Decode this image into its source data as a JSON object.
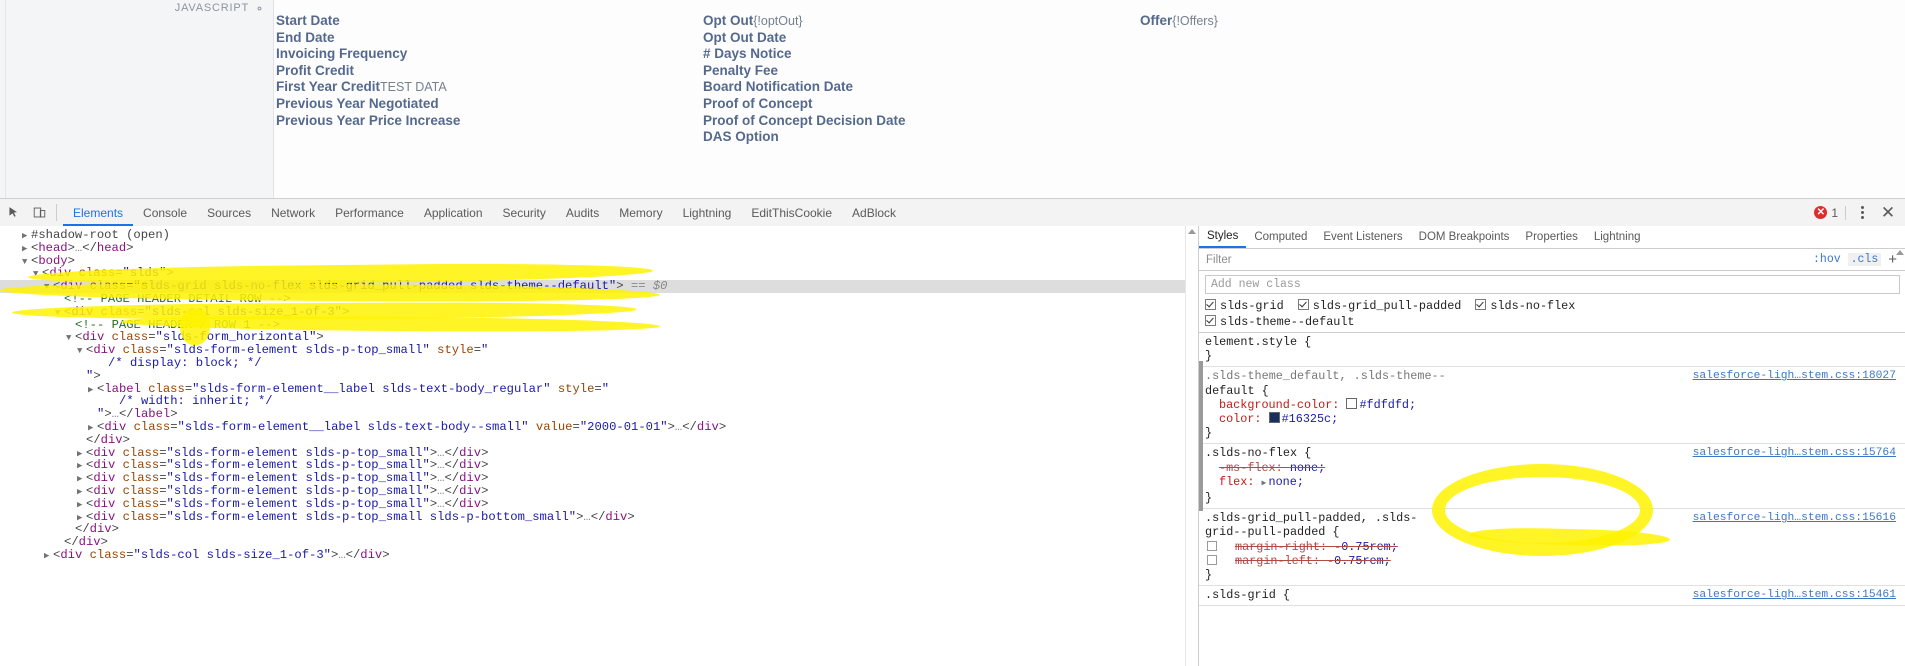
{
  "page": {
    "javascript_badge": "JAVASCRIPT",
    "gear_icon": "gear-icon",
    "columns": [
      {
        "name": "column-1",
        "fields": [
          {
            "label": "Start Date",
            "value": ""
          },
          {
            "label": "End Date",
            "value": ""
          },
          {
            "label": "Invoicing Frequency",
            "value": ""
          },
          {
            "label": "Profit Credit",
            "value": ""
          },
          {
            "label": "First Year Credit",
            "value": "TEST DATA"
          },
          {
            "label": "Previous Year Negotiated",
            "value": ""
          },
          {
            "label": "Previous Year Price Increase",
            "value": ""
          }
        ]
      },
      {
        "name": "column-2",
        "fields": [
          {
            "label": "Opt Out",
            "value": "{!optOut}"
          },
          {
            "label": "Opt Out Date",
            "value": ""
          },
          {
            "label": "# Days Notice",
            "value": ""
          },
          {
            "label": "Penalty Fee",
            "value": ""
          },
          {
            "label": "Board Notification Date",
            "value": ""
          },
          {
            "label": "Proof of Concept",
            "value": ""
          },
          {
            "label": "Proof of Concept Decision Date",
            "value": ""
          },
          {
            "label": "DAS Option",
            "value": ""
          }
        ]
      },
      {
        "name": "column-3",
        "fields": [
          {
            "label": "Offer",
            "value": "{!Offers}"
          }
        ]
      }
    ]
  },
  "devtools": {
    "tabs": [
      {
        "label": "Elements",
        "active": true
      },
      {
        "label": "Console",
        "active": false
      },
      {
        "label": "Sources",
        "active": false
      },
      {
        "label": "Network",
        "active": false
      },
      {
        "label": "Performance",
        "active": false
      },
      {
        "label": "Application",
        "active": false
      },
      {
        "label": "Security",
        "active": false
      },
      {
        "label": "Audits",
        "active": false
      },
      {
        "label": "Memory",
        "active": false
      },
      {
        "label": "Lightning",
        "active": false
      },
      {
        "label": "EditThisCookie",
        "active": false
      },
      {
        "label": "AdBlock",
        "active": false
      }
    ],
    "inspect_icon": "cursor-inspect-icon",
    "device_icon": "device-toolbar-icon",
    "error_count": "1",
    "error_icon": "error-circle-icon",
    "menu_icon": "kebab-menu-icon",
    "close_icon": "close-icon",
    "dom": {
      "lines": [
        {
          "indent": 2,
          "tri": "closed",
          "html": "<span class=\"shadow\">#shadow-root (open)</span>"
        },
        {
          "indent": 2,
          "tri": "closed",
          "html": "<span class=\"pun\">&lt;</span><span class=\"tg\">head</span><span class=\"pun\">&gt;</span><span class=\"ell\">…</span><span class=\"pun\">&lt;/</span><span class=\"tg\">head</span><span class=\"pun\">&gt;</span>"
        },
        {
          "indent": 2,
          "tri": "open",
          "html": "<span class=\"pun\">&lt;</span><span class=\"tg\">body</span><span class=\"pun\">&gt;</span>"
        },
        {
          "indent": 3,
          "tri": "open",
          "html": "<span class=\"pun\">&lt;</span><span class=\"tg\">div</span> <span class=\"at\">class</span><span class=\"pun\">=</span><span class=\"av\">\"slds\"</span><span class=\"pun\">&gt;</span>"
        },
        {
          "indent": 4,
          "tri": "open",
          "sel": true,
          "html": "<span class=\"pun\">&lt;</span><span class=\"tg\">div</span> <span class=\"at\">class</span><span class=\"pun\">=</span><span class=\"av\">\"slds-grid slds-no-flex slds-grid_pull-padded slds-theme--default\"</span><span class=\"pun\">&gt;</span> <span class=\"eq0\">== $0</span>"
        },
        {
          "indent": 5,
          "tri": "none",
          "html": "<span class=\"cmt\">&lt;!-- PAGE HEADER DETAIL ROW --&gt;</span>"
        },
        {
          "indent": 5,
          "tri": "open",
          "html": "<span class=\"pun\">&lt;</span><span class=\"tg\">div</span> <span class=\"at\">class</span><span class=\"pun\">=</span><span class=\"av\">\"slds-col slds-size_1-of-3\"</span><span class=\"pun\">&gt;</span>"
        },
        {
          "indent": 6,
          "tri": "none",
          "html": "<span class=\"cmt\">&lt;!-- PAGE HEADER / ROW 1 --&gt;</span>"
        },
        {
          "indent": 6,
          "tri": "open",
          "html": "<span class=\"pun\">&lt;</span><span class=\"tg\">div</span> <span class=\"at\">class</span><span class=\"pun\">=</span><span class=\"av\">\"slds-form_horizontal\"</span><span class=\"pun\">&gt;</span>"
        },
        {
          "indent": 7,
          "tri": "open",
          "html": "<span class=\"pun\">&lt;</span><span class=\"tg\">div</span> <span class=\"at\">class</span><span class=\"pun\">=</span><span class=\"av\">\"slds-form-element slds-p-top_small\"</span> <span class=\"at\">style</span><span class=\"pun\">=</span><span class=\"av\">\"</span>"
        },
        {
          "indent": 9,
          "tri": "none",
          "html": "<span class=\"av\">/* display: block; */</span>"
        },
        {
          "indent": 7,
          "tri": "none",
          "html": "<span class=\"av\">\"</span><span class=\"pun\">&gt;</span>"
        },
        {
          "indent": 8,
          "tri": "closed",
          "html": "<span class=\"pun\">&lt;</span><span class=\"tg\">label</span> <span class=\"at\">class</span><span class=\"pun\">=</span><span class=\"av\">\"slds-form-element__label slds-text-body_regular\"</span> <span class=\"at\">style</span><span class=\"pun\">=</span><span class=\"av\">\"</span>"
        },
        {
          "indent": 10,
          "tri": "none",
          "html": "<span class=\"av\">/* width: inherit; */</span>"
        },
        {
          "indent": 8,
          "tri": "none",
          "html": "<span class=\"av\">\"</span><span class=\"pun\">&gt;</span><span class=\"ell\">…</span><span class=\"pun\">&lt;/</span><span class=\"tg\">label</span><span class=\"pun\">&gt;</span>"
        },
        {
          "indent": 8,
          "tri": "closed",
          "html": "<span class=\"pun\">&lt;</span><span class=\"tg\">div</span> <span class=\"at\">class</span><span class=\"pun\">=</span><span class=\"av\">\"slds-form-element__label slds-text-body--small\"</span> <span class=\"at\">value</span><span class=\"pun\">=</span><span class=\"av\">\"2000-01-01\"</span><span class=\"pun\">&gt;</span><span class=\"ell\">…</span><span class=\"pun\">&lt;/</span><span class=\"tg\">div</span><span class=\"pun\">&gt;</span>"
        },
        {
          "indent": 7,
          "tri": "none",
          "html": "<span class=\"pun\">&lt;/</span><span class=\"tg\">div</span><span class=\"pun\">&gt;</span>"
        },
        {
          "indent": 7,
          "tri": "closed",
          "html": "<span class=\"pun\">&lt;</span><span class=\"tg\">div</span> <span class=\"at\">class</span><span class=\"pun\">=</span><span class=\"av\">\"slds-form-element slds-p-top_small\"</span><span class=\"pun\">&gt;</span><span class=\"ell\">…</span><span class=\"pun\">&lt;/</span><span class=\"tg\">div</span><span class=\"pun\">&gt;</span>"
        },
        {
          "indent": 7,
          "tri": "closed",
          "html": "<span class=\"pun\">&lt;</span><span class=\"tg\">div</span> <span class=\"at\">class</span><span class=\"pun\">=</span><span class=\"av\">\"slds-form-element slds-p-top_small\"</span><span class=\"pun\">&gt;</span><span class=\"ell\">…</span><span class=\"pun\">&lt;/</span><span class=\"tg\">div</span><span class=\"pun\">&gt;</span>"
        },
        {
          "indent": 7,
          "tri": "closed",
          "html": "<span class=\"pun\">&lt;</span><span class=\"tg\">div</span> <span class=\"at\">class</span><span class=\"pun\">=</span><span class=\"av\">\"slds-form-element slds-p-top_small\"</span><span class=\"pun\">&gt;</span><span class=\"ell\">…</span><span class=\"pun\">&lt;/</span><span class=\"tg\">div</span><span class=\"pun\">&gt;</span>"
        },
        {
          "indent": 7,
          "tri": "closed",
          "html": "<span class=\"pun\">&lt;</span><span class=\"tg\">div</span> <span class=\"at\">class</span><span class=\"pun\">=</span><span class=\"av\">\"slds-form-element slds-p-top_small\"</span><span class=\"pun\">&gt;</span><span class=\"ell\">…</span><span class=\"pun\">&lt;/</span><span class=\"tg\">div</span><span class=\"pun\">&gt;</span>"
        },
        {
          "indent": 7,
          "tri": "closed",
          "html": "<span class=\"pun\">&lt;</span><span class=\"tg\">div</span> <span class=\"at\">class</span><span class=\"pun\">=</span><span class=\"av\">\"slds-form-element slds-p-top_small\"</span><span class=\"pun\">&gt;</span><span class=\"ell\">…</span><span class=\"pun\">&lt;/</span><span class=\"tg\">div</span><span class=\"pun\">&gt;</span>"
        },
        {
          "indent": 7,
          "tri": "closed",
          "html": "<span class=\"pun\">&lt;</span><span class=\"tg\">div</span> <span class=\"at\">class</span><span class=\"pun\">=</span><span class=\"av\">\"slds-form-element slds-p-top_small slds-p-bottom_small\"</span><span class=\"pun\">&gt;</span><span class=\"ell\">…</span><span class=\"pun\">&lt;/</span><span class=\"tg\">div</span><span class=\"pun\">&gt;</span>"
        },
        {
          "indent": 6,
          "tri": "none",
          "html": "<span class=\"pun\">&lt;/</span><span class=\"tg\">div</span><span class=\"pun\">&gt;</span>"
        },
        {
          "indent": 5,
          "tri": "none",
          "html": "<span class=\"pun\">&lt;/</span><span class=\"tg\">div</span><span class=\"pun\">&gt;</span>"
        },
        {
          "indent": 4,
          "tri": "closed",
          "html": "<span class=\"pun\">&lt;</span><span class=\"tg\">div</span> <span class=\"at\">class</span><span class=\"pun\">=</span><span class=\"av\">\"slds-col slds-size_1-of-3\"</span><span class=\"pun\">&gt;</span><span class=\"ell\">…</span><span class=\"pun\">&lt;/</span><span class=\"tg\">div</span><span class=\"pun\">&gt;</span>"
        }
      ]
    },
    "styles": {
      "tabs": [
        {
          "label": "Styles",
          "active": true
        },
        {
          "label": "Computed",
          "active": false
        },
        {
          "label": "Event Listeners",
          "active": false
        },
        {
          "label": "DOM Breakpoints",
          "active": false
        },
        {
          "label": "Properties",
          "active": false
        },
        {
          "label": "Lightning",
          "active": false
        }
      ],
      "filter_placeholder": "Filter",
      "hov_label": ":hov",
      "cls_label": ".cls",
      "plus_label": "+",
      "add_class_placeholder": "Add new class",
      "class_toggles": [
        {
          "name": "slds-grid",
          "checked": true
        },
        {
          "name": "slds-grid_pull-padded",
          "checked": true
        },
        {
          "name": "slds-no-flex",
          "checked": true
        },
        {
          "name": "slds-theme--default",
          "checked": true
        }
      ],
      "rules": [
        {
          "selector": "element.style {",
          "selector_muted": false,
          "source": "",
          "declarations": [],
          "close": "}"
        },
        {
          "selector": ".slds-theme_default, .slds-theme--",
          "selector_line2": "default {",
          "selector_muted": true,
          "source": "salesforce-ligh…stem.css:18027",
          "declarations": [
            {
              "prop": "background-color:",
              "value": "#fdfdfd;",
              "swatch": "#fdfdfd",
              "strike": false,
              "checkbox": false,
              "expand": false
            },
            {
              "prop": "color:",
              "value": "#16325c;",
              "swatch": "#16325c",
              "strike": false,
              "checkbox": false,
              "expand": false
            }
          ],
          "close": "}"
        },
        {
          "selector": ".slds-no-flex {",
          "selector_muted": false,
          "source": "salesforce-ligh…stem.css:15764",
          "declarations": [
            {
              "prop": "-ms-flex:",
              "value": "none;",
              "swatch": "",
              "strike": true,
              "checkbox": false,
              "expand": false
            },
            {
              "prop": "flex:",
              "value": "none;",
              "swatch": "",
              "strike": false,
              "checkbox": false,
              "expand": true
            }
          ],
          "close": "}"
        },
        {
          "selector": ".slds-grid_pull-padded, .slds-",
          "selector_line2": "grid--pull-padded {",
          "selector_muted": false,
          "source": "salesforce-ligh…stem.css:15616",
          "declarations": [
            {
              "prop": "margin-right:",
              "value": "-0.75rem;",
              "swatch": "",
              "strike": true,
              "checkbox": true,
              "expand": false
            },
            {
              "prop": "margin-left:",
              "value": "-0.75rem;",
              "swatch": "",
              "strike": true,
              "checkbox": true,
              "expand": false
            }
          ],
          "close": "}"
        },
        {
          "selector": ".slds-grid {",
          "selector_muted": false,
          "source": "salesforce-ligh…stem.css:15461",
          "declarations": [],
          "close": ""
        }
      ]
    }
  },
  "colors": {
    "accent": "#1a73e8",
    "label": "#54698d",
    "highlighter": "#fff200",
    "error": "#df2b2b"
  }
}
